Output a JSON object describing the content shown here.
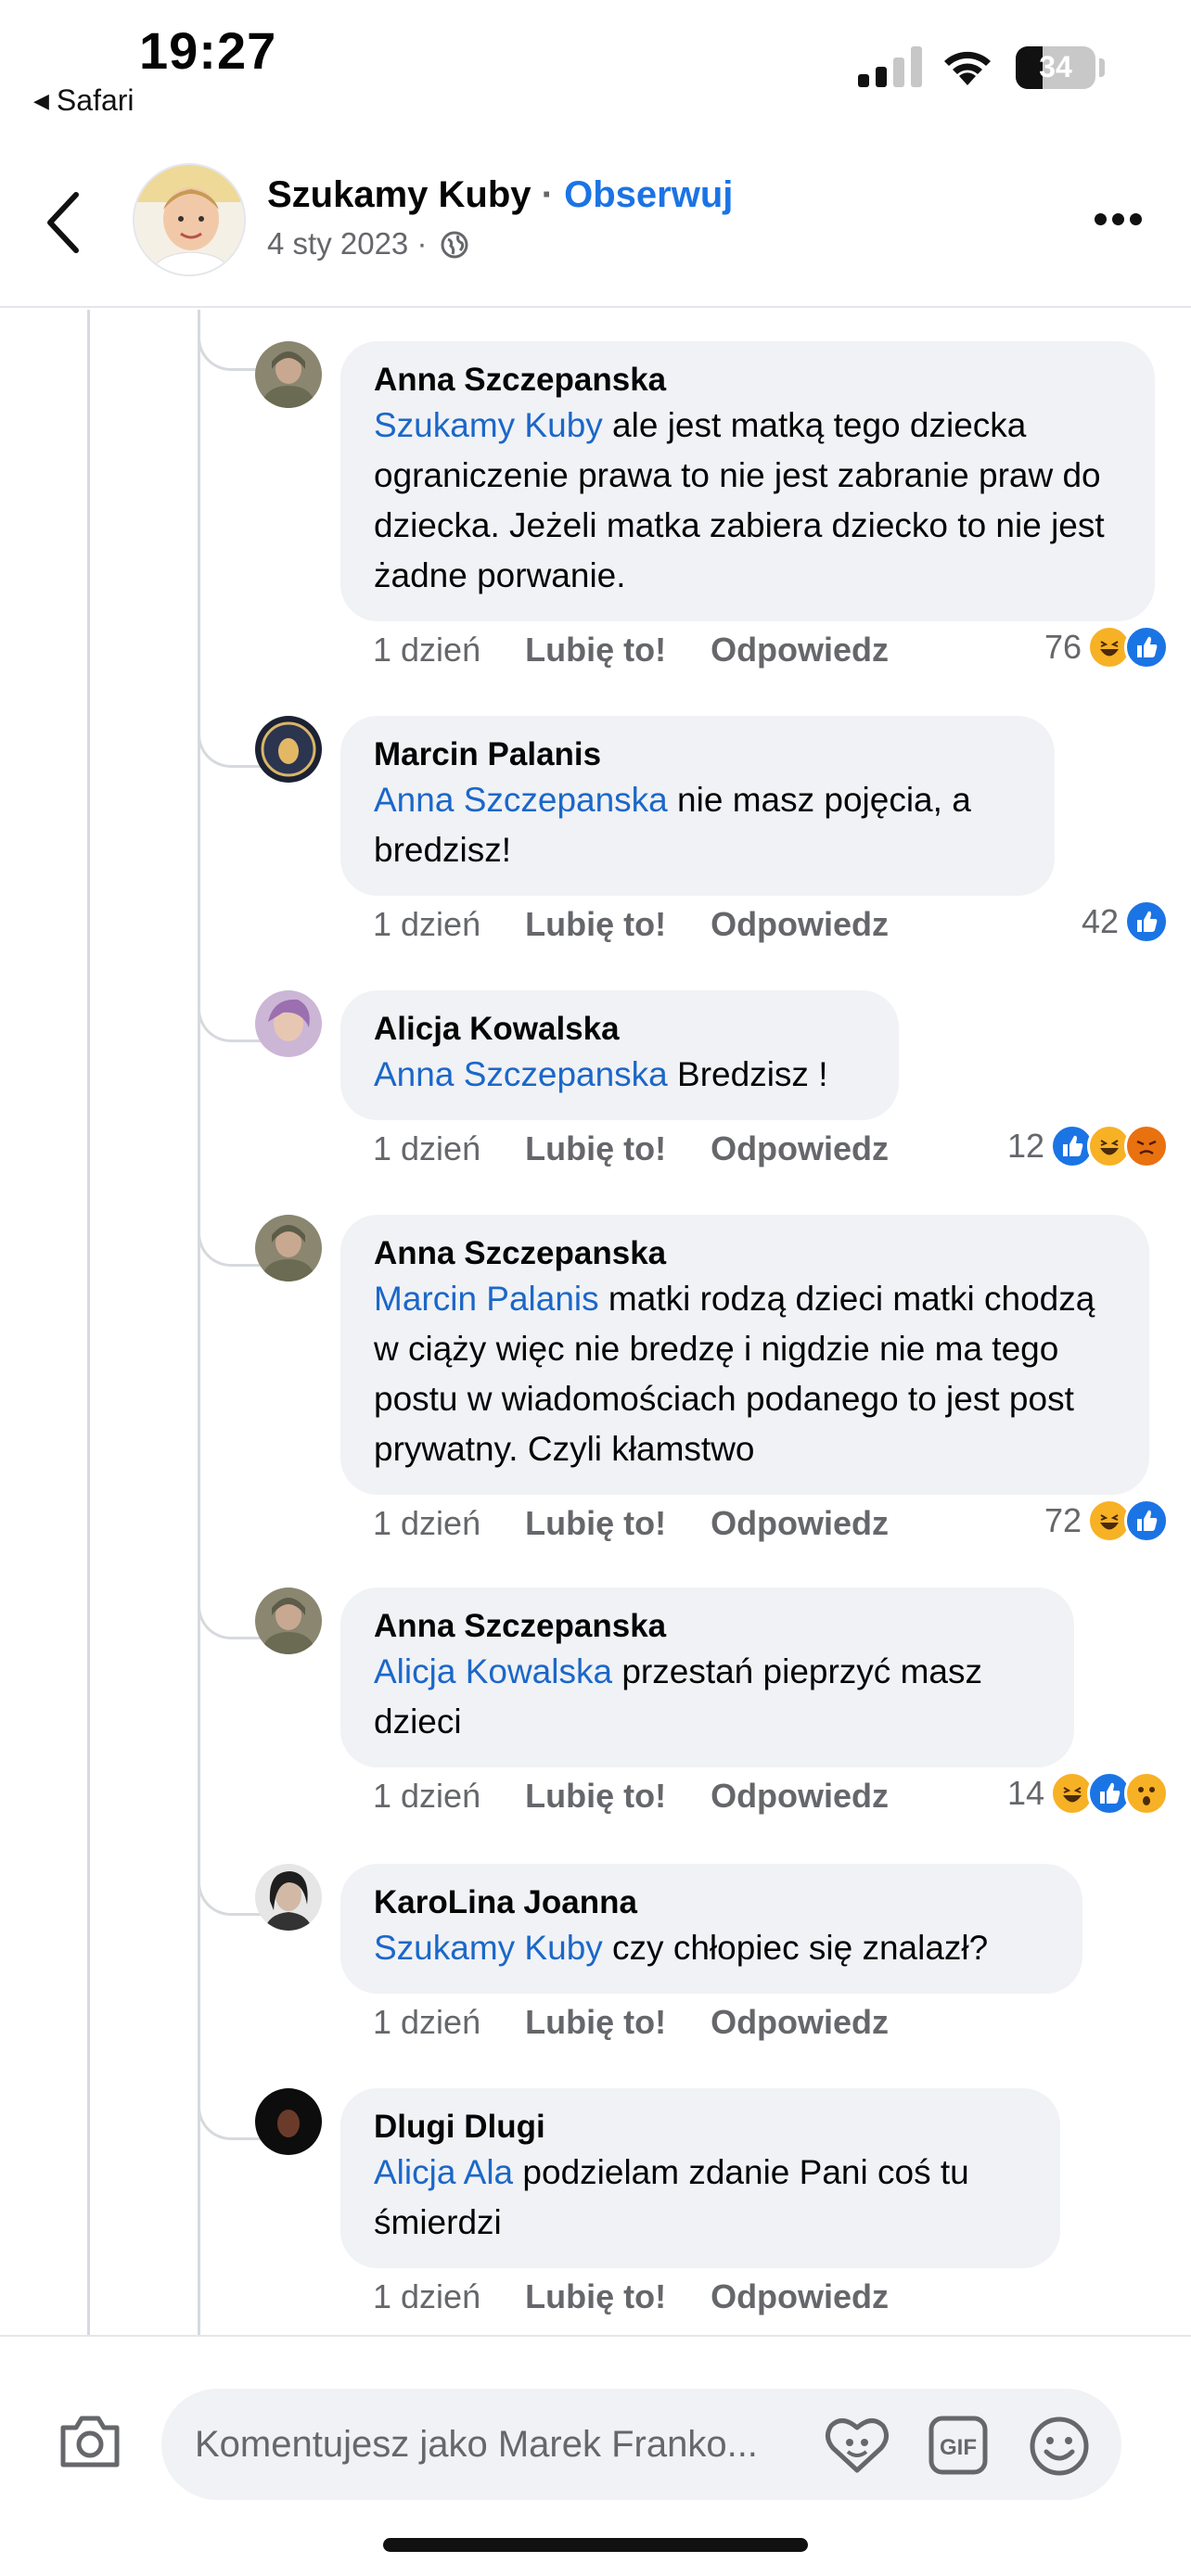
{
  "status_bar": {
    "time": "19:27",
    "back_app": "Safari",
    "battery": "34"
  },
  "header": {
    "page_name": "Szukamy Kuby",
    "separator": "·",
    "follow_label": "Obserwuj",
    "date": "4 sty 2023 ·"
  },
  "comments": [
    {
      "author": "Anna Szczepanska",
      "mention": "Szukamy Kuby",
      "text": " ale jest matką tego dziecka ograniczenie prawa to nie jest zabranie praw do dziecka. Jeżeli matka zabiera dziecko to nie jest żadne porwanie.",
      "time": "1 dzień",
      "like": "Lubię to!",
      "reply": "Odpowiedz",
      "reaction_count": "76",
      "reactions": [
        "haha",
        "like"
      ]
    },
    {
      "author": "Marcin Palanis",
      "mention": "Anna Szczepanska",
      "text": " nie masz pojęcia, a bredzisz!",
      "time": "1 dzień",
      "like": "Lubię to!",
      "reply": "Odpowiedz",
      "reaction_count": "42",
      "reactions": [
        "like"
      ]
    },
    {
      "author": "Alicja Kowalska",
      "mention": "Anna Szczepanska",
      "text": " Bredzisz !",
      "time": "1 dzień",
      "like": "Lubię to!",
      "reply": "Odpowiedz",
      "reaction_count": "12",
      "reactions": [
        "like",
        "haha",
        "angry"
      ]
    },
    {
      "author": "Anna Szczepanska",
      "mention": "Marcin Palanis",
      "text": " matki rodzą dzieci matki chodzą w ciąży więc nie bredzę i nigdzie nie ma tego postu w wiadomościach podanego to jest post prywatny. Czyli kłamstwo",
      "time": "1 dzień",
      "like": "Lubię to!",
      "reply": "Odpowiedz",
      "reaction_count": "72",
      "reactions": [
        "haha",
        "like"
      ]
    },
    {
      "author": "Anna Szczepanska",
      "mention": "Alicja Kowalska",
      "text": " przestań pieprzyć masz dzieci",
      "time": "1 dzień",
      "like": "Lubię to!",
      "reply": "Odpowiedz",
      "reaction_count": "14",
      "reactions": [
        "haha",
        "like",
        "wow"
      ]
    },
    {
      "author": "KaroLina Joanna",
      "mention": "Szukamy Kuby",
      "text": " czy chłopiec się znalazł?",
      "time": "1 dzień",
      "like": "Lubię to!",
      "reply": "Odpowiedz",
      "reaction_count": "",
      "reactions": []
    },
    {
      "author": "Dlugi Dlugi",
      "mention": "Alicja Ala",
      "text": " podzielam zdanie Pani coś tu śmierdzi",
      "time": "1 dzień",
      "like": "Lubię to!",
      "reply": "Odpowiedz",
      "reaction_count": "",
      "reactions": []
    }
  ],
  "composer": {
    "placeholder": "Komentujesz jako Marek Franko..."
  },
  "colors": {
    "accent": "#1b74e4",
    "mention": "#1b67c9",
    "bubble": "#f0f2f5",
    "muted": "#65676b"
  }
}
